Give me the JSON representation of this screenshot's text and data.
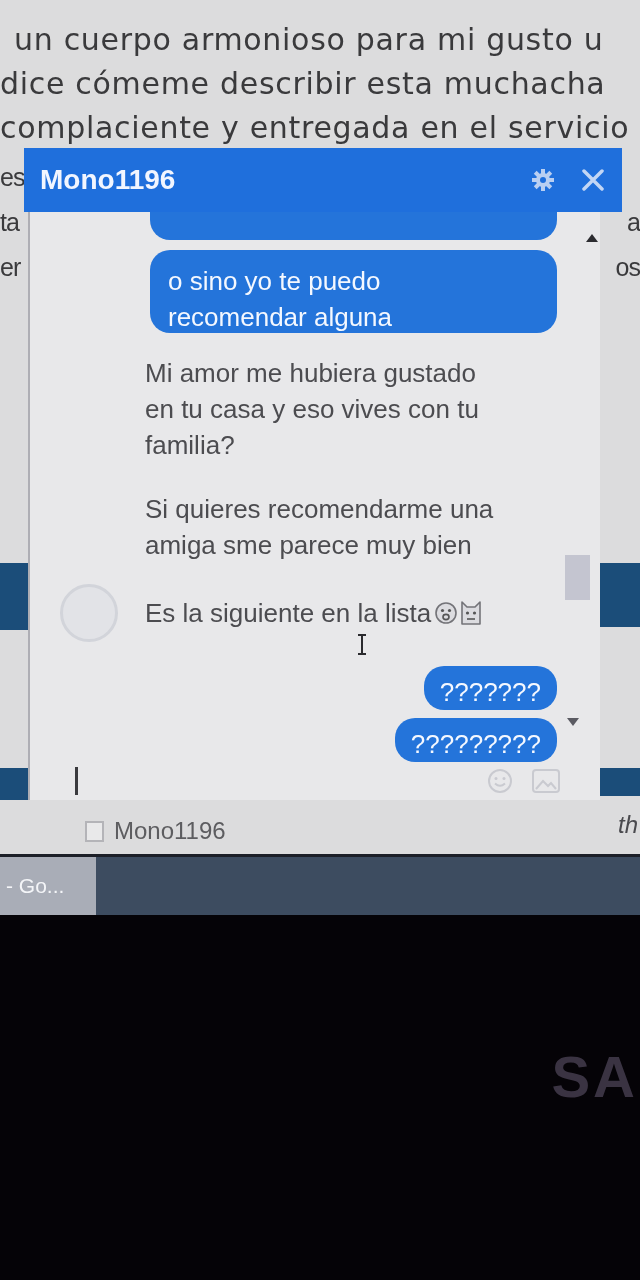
{
  "background_page": {
    "article_lines": [
      "un cuerpo armonioso para mi gusto u",
      "dice cómeme describir esta muchacha",
      "complaciente y entregada en el servicio"
    ],
    "left_fragments": [
      "es",
      "ta",
      "er"
    ],
    "right_fragments": [
      "a",
      "os"
    ],
    "chat_tab": {
      "label": "Mono1196",
      "checked": false
    },
    "right_footer_fragment": "th"
  },
  "chat_window": {
    "title": "Mono1196",
    "messages": [
      {
        "kind": "sent",
        "has_emoji": false
      },
      {
        "kind": "sent",
        "text": "o sino yo te puedo recomendar alguna",
        "has_emoji": false
      },
      {
        "kind": "received",
        "text": "Mi amor me hubiera gustado en tu casa y eso vives con tu familia?",
        "has_emoji": false
      },
      {
        "kind": "received",
        "text": "Si quieres recomendarme una amiga sme parece muy bien",
        "has_emoji": false
      },
      {
        "kind": "received",
        "text": "Es la siguiente en la lista",
        "has_emoji": true
      },
      {
        "kind": "sent",
        "text": "???????",
        "has_emoji": false
      },
      {
        "kind": "sent",
        "text": "?????????",
        "has_emoji": false
      }
    ]
  },
  "taskbar": {
    "button": "- Go..."
  },
  "bezel": {
    "logo": "SA"
  }
}
